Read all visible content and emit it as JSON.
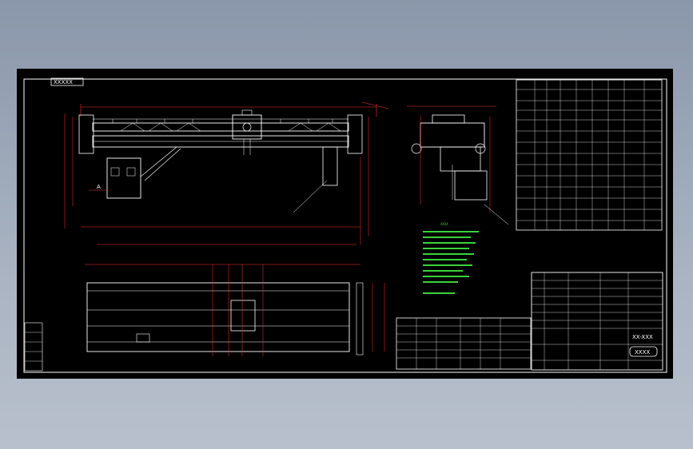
{
  "drawing": {
    "title_tag": "XXXXX",
    "sheet_code": "XX-XXX",
    "company_logo": "XXXX",
    "section_label": "A",
    "notes_title": "XXXX"
  },
  "colors": {
    "background": "#000000",
    "border": "#ffffff",
    "geometry": "#ffffff",
    "dimension": "#ff3030",
    "table_grid": "#ffffff",
    "table_text": "#00d0d0",
    "title_block_text": "#39d33a",
    "notes_text": "#39d33a",
    "hatch_cyan": "#00c8ff"
  },
  "icons": [
    "cad-logo-icon",
    "section-marker-icon"
  ]
}
